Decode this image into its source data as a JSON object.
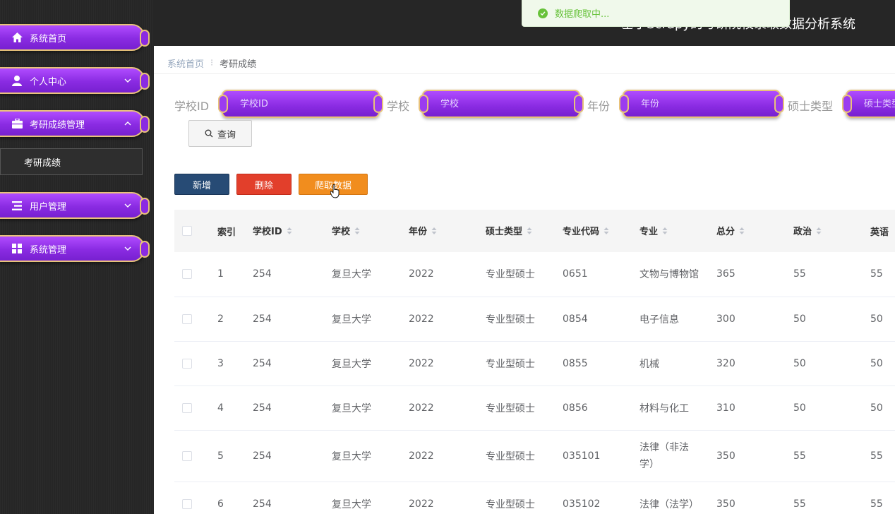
{
  "sidebar": {
    "items": [
      {
        "label": "系统首页",
        "icon": "home-icon"
      },
      {
        "label": "个人中心",
        "icon": "user-icon"
      },
      {
        "label": "考研成绩管理",
        "icon": "briefcase-icon"
      },
      {
        "label": "用户管理",
        "icon": "list-icon"
      },
      {
        "label": "系统管理",
        "icon": "grid-icon"
      }
    ],
    "submenu": {
      "label": "考研成绩"
    }
  },
  "header": {
    "title": "基于Scrapy的考研院校录取数据分析系统",
    "toast": "数据爬取中..."
  },
  "breadcrumb": {
    "home": "系统首页",
    "separator": "⁝",
    "current": "考研成绩"
  },
  "search": {
    "fields": [
      {
        "label": "学校ID",
        "placeholder": "学校ID"
      },
      {
        "label": "学校",
        "placeholder": "学校"
      },
      {
        "label": "年份",
        "placeholder": "年份"
      },
      {
        "label": "硕士类型",
        "placeholder": "硕士类型"
      }
    ],
    "query_label": "查询"
  },
  "actions": {
    "add": "新增",
    "delete": "删除",
    "crawl": "爬取数据"
  },
  "table": {
    "columns": [
      "索引",
      "学校ID",
      "学校",
      "年份",
      "硕士类型",
      "专业代码",
      "专业",
      "总分",
      "政治",
      "英语"
    ],
    "rows": [
      [
        "1",
        "254",
        "复旦大学",
        "2022",
        "专业型硕士",
        "0651",
        "文物与博物馆",
        "365",
        "55",
        "55"
      ],
      [
        "2",
        "254",
        "复旦大学",
        "2022",
        "专业型硕士",
        "0854",
        "电子信息",
        "300",
        "50",
        "50"
      ],
      [
        "3",
        "254",
        "复旦大学",
        "2022",
        "专业型硕士",
        "0855",
        "机械",
        "320",
        "50",
        "50"
      ],
      [
        "4",
        "254",
        "复旦大学",
        "2022",
        "专业型硕士",
        "0856",
        "材料与化工",
        "310",
        "50",
        "50"
      ],
      [
        "5",
        "254",
        "复旦大学",
        "2022",
        "专业型硕士",
        "035101",
        "法律（非法学）",
        "350",
        "55",
        "55"
      ],
      [
        "6",
        "254",
        "复旦大学",
        "2022",
        "专业型硕士",
        "035102",
        "法律（法学）",
        "350",
        "55",
        "55"
      ]
    ]
  },
  "colors": {
    "accent_purple": "#8a2be2",
    "gold_border": "#e8c27a",
    "add_btn": "#274b75",
    "delete_btn": "#e23f2b",
    "crawl_btn": "#f18d1e",
    "success": "#67c23a"
  }
}
